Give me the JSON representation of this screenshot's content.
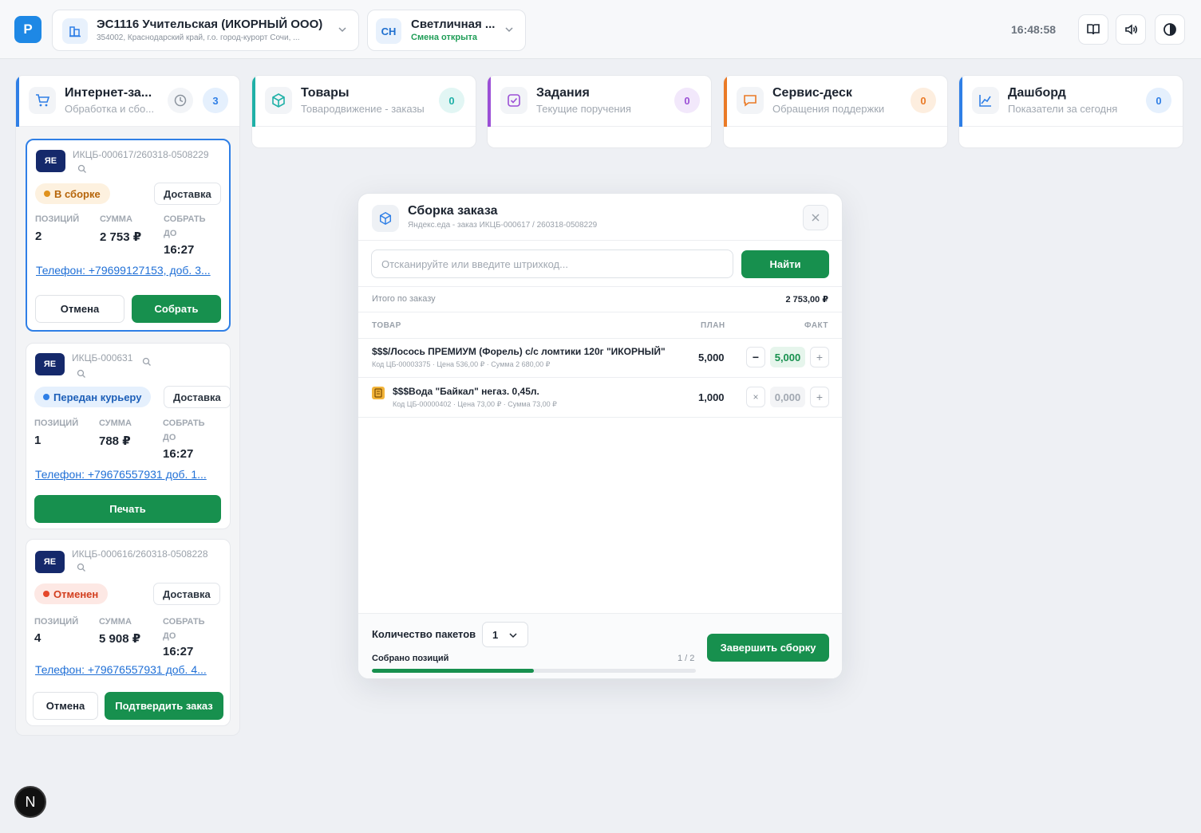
{
  "app": {
    "logo": "P",
    "clock": "16:48:58"
  },
  "store": {
    "name": "ЭС1116 Учительская (ИКОРНЫЙ ООО)",
    "address": "354002, Краснодарский край, г.о. город-курорт Сочи, ..."
  },
  "user": {
    "initials": "СН",
    "name": "Светличная ...",
    "shift": "Смена открыта"
  },
  "tiles": [
    {
      "title": "Интернет-за...",
      "subtitle": "Обработка и сбо...",
      "count": "3",
      "color": "#2f7fe6"
    },
    {
      "title": "Товары",
      "subtitle": "Товародвижение - заказы",
      "count": "0",
      "color": "#1fb0a7"
    },
    {
      "title": "Задания",
      "subtitle": "Текущие поручения",
      "count": "0",
      "color": "#9b4fd6"
    },
    {
      "title": "Сервис-деск",
      "subtitle": "Обращения поддержки",
      "count": "0",
      "color": "#ea7a26"
    },
    {
      "title": "Дашборд",
      "subtitle": "Показатели за сегодня",
      "count": "0",
      "color": "#2f7fe6"
    }
  ],
  "labels": {
    "positions": "ПОЗИЦИЙ",
    "sum": "СУММА",
    "collect_by": "СОБРАТЬ ДО"
  },
  "orders": [
    {
      "badge": "ЯЕ",
      "number": "ИКЦБ-000617/260318-0508229",
      "status": "В сборке",
      "delivery": "Доставка",
      "positions": "2",
      "sum": "2 753 ₽",
      "time": "16:27",
      "phone": "Телефон: +79699127153, доб. 3...",
      "btn_cancel": "Отмена",
      "btn_primary": "Собрать"
    },
    {
      "badge": "ЯЕ",
      "number": "ИКЦБ-000631",
      "status": "Передан курьеру",
      "delivery": "Доставка",
      "positions": "1",
      "sum": "788 ₽",
      "time": "16:27",
      "phone": "Телефон: +79676557931 доб. 1...",
      "btn_primary": "Печать"
    },
    {
      "badge": "ЯЕ",
      "number": "ИКЦБ-000616/260318-0508228",
      "status": "Отменен",
      "delivery": "Доставка",
      "positions": "4",
      "sum": "5 908 ₽",
      "time": "16:27",
      "phone": "Телефон: +79676557931 доб. 4...",
      "btn_cancel": "Отмена",
      "btn_primary": "Подтвердить заказ"
    }
  ],
  "modal": {
    "title": "Сборка заказа",
    "subtitle": "Яндекс.еда - заказ ИКЦБ-000617 / 260318-0508229",
    "scan_placeholder": "Отсканируйте или введите штрихкод...",
    "find_label": "Найти",
    "total_label": "Итого по заказу",
    "total_value": "2 753,00 ₽",
    "columns": {
      "product": "ТОВАР",
      "plan": "ПЛАН",
      "fact": "ФАКТ"
    },
    "items": [
      {
        "name": "$$$/Лосось ПРЕМИУМ (Форель) с/с ломтики 120г \"ИКОРНЫЙ\"",
        "meta": "Код ЦБ-00003375 · Цена 536,00 ₽ · Сумма 2 680,00 ₽",
        "plan": "5,000",
        "fact": "5,000"
      },
      {
        "name": "$$$Вода \"Байкал\" негаз. 0,45л.",
        "meta": "Код ЦБ-00000402 · Цена 73,00 ₽ · Сумма 73,00 ₽",
        "plan": "1,000",
        "fact": "0,000"
      }
    ],
    "packages_label": "Количество пакетов",
    "packages_value": "1",
    "collected_label": "Собрано позиций",
    "collected_value": "1 / 2",
    "collected_fraction": 0.5,
    "finish_label": "Завершить сборку"
  },
  "fab": "N"
}
